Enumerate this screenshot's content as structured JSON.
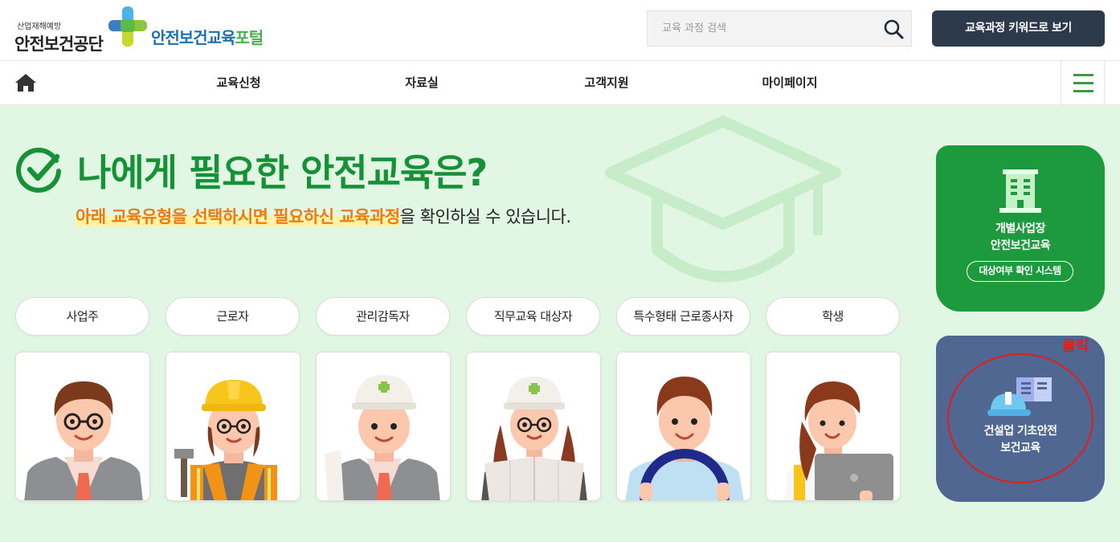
{
  "header": {
    "org_small": "산업재해예방",
    "org_name": "안전보건공단",
    "portal_name_blue": "안전보건교육",
    "portal_name_green": "포털",
    "search_placeholder": "교육 과정 검색",
    "keyword_button": "교육과정 키워드로 보기"
  },
  "nav": {
    "items": [
      "교육신청",
      "자료실",
      "고객지원",
      "마이페이지"
    ]
  },
  "hero": {
    "title": "나에게 필요한 안전교육은?",
    "subtitle_highlight": "아래 교육유형을 선택하시면 필요하신 교육과정",
    "subtitle_rest": "을 확인하실 수 있습니다.",
    "categories": [
      "사업주",
      "근로자",
      "관리감독자",
      "직무교육 대상자",
      "특수형태 근로종사자",
      "학생"
    ]
  },
  "side": {
    "card1": {
      "line1": "개별사업장",
      "line2": "안전보건교육",
      "button": "대상여부 확인 시스템"
    },
    "card2": {
      "line1": "건설업 기초안전",
      "line2": "보건교육"
    },
    "click_label": "클릭"
  },
  "colors": {
    "green": "#169137",
    "navy": "#2d3a4b",
    "orange": "#f07a10",
    "hero_bg": "#e1f7e3",
    "side_blue": "#4f6791",
    "red_marker": "#e01e1e"
  }
}
